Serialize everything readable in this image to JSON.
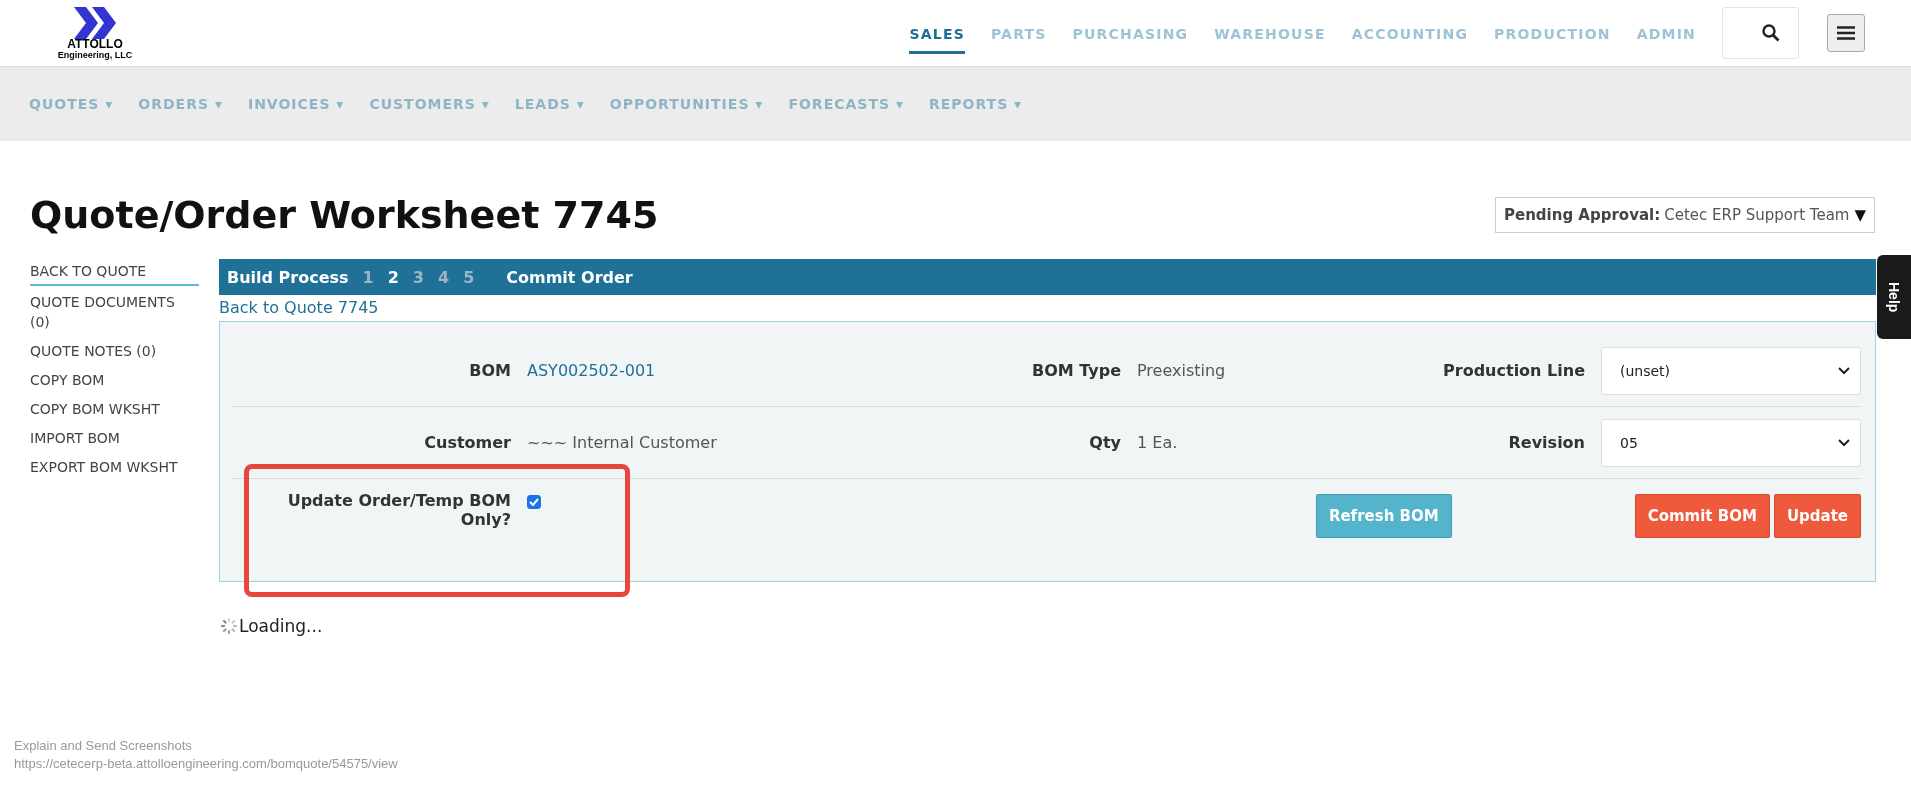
{
  "logo": {
    "name": "ATTOLLO",
    "subtitle": "Engineering, LLC"
  },
  "main_nav": [
    {
      "label": "SALES",
      "selected": true
    },
    {
      "label": "PARTS",
      "selected": false
    },
    {
      "label": "PURCHASING",
      "selected": false
    },
    {
      "label": "WAREHOUSE",
      "selected": false
    },
    {
      "label": "ACCOUNTING",
      "selected": false
    },
    {
      "label": "PRODUCTION",
      "selected": false
    },
    {
      "label": "ADMIN",
      "selected": false
    }
  ],
  "sub_nav": [
    {
      "label": "QUOTES ▾"
    },
    {
      "label": "ORDERS ▾"
    },
    {
      "label": "INVOICES ▾"
    },
    {
      "label": "CUSTOMERS ▾"
    },
    {
      "label": "LEADS ▾"
    },
    {
      "label": "OPPORTUNITIES ▾"
    },
    {
      "label": "FORECASTS ▾"
    },
    {
      "label": "REPORTS ▾"
    }
  ],
  "title": "Quote/Order Worksheet 7745",
  "approval": {
    "label": "Pending Approval:",
    "value": "Cetec ERP Support Team",
    "caret": "▼"
  },
  "sidebar": [
    {
      "label": "BACK TO QUOTE",
      "selected": true
    },
    {
      "label": "QUOTE DOCUMENTS (0)",
      "selected": false
    },
    {
      "label": "QUOTE NOTES (0)",
      "selected": false
    },
    {
      "label": "COPY BOM",
      "selected": false
    },
    {
      "label": "COPY BOM WKSHT",
      "selected": false
    },
    {
      "label": "IMPORT BOM",
      "selected": false
    },
    {
      "label": "EXPORT BOM WKSHT",
      "selected": false
    }
  ],
  "build_process": {
    "label": "Build Process",
    "steps": [
      {
        "label": "1",
        "selected": false
      },
      {
        "label": "2",
        "selected": true
      },
      {
        "label": "3",
        "selected": false
      },
      {
        "label": "4",
        "selected": false
      },
      {
        "label": "5",
        "selected": false
      }
    ],
    "commit": "Commit Order"
  },
  "back_link": "Back to Quote 7745",
  "form": {
    "rows": [
      {
        "fields": [
          {
            "label": "BOM",
            "value": "ASY002502-001",
            "kind": "link"
          },
          {
            "label": "BOM Type",
            "value": "Preexisting",
            "kind": "text"
          },
          {
            "label": "Production Line",
            "value": "(unset)",
            "kind": "select"
          }
        ]
      },
      {
        "fields": [
          {
            "label": "Customer",
            "value": "~~~ Internal Customer",
            "kind": "text"
          },
          {
            "label": "Qty",
            "value": "1 Ea.",
            "kind": "text"
          },
          {
            "label": "Revision",
            "value": "05",
            "kind": "select"
          }
        ]
      }
    ],
    "update_only": {
      "label": "Update Order/Temp BOM Only?",
      "checked": true
    },
    "buttons": [
      {
        "label": "Refresh BOM",
        "kind": "info"
      },
      {
        "label": "Commit BOM",
        "kind": "danger"
      },
      {
        "label": "Update",
        "kind": "danger"
      }
    ]
  },
  "loading": "Loading...",
  "help_tab": "Help",
  "status": {
    "caption": "Explain and Send Screenshots",
    "url": "https://cetecerp-beta.attolloengineering.com/bomquote/54575/view"
  }
}
